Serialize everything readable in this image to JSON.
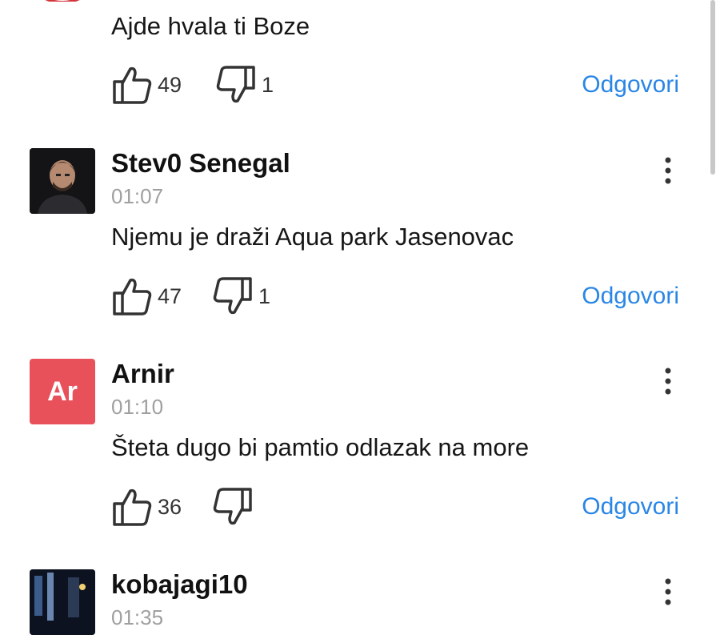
{
  "comments": [
    {
      "user": "",
      "time": "",
      "text": "Ajde hvala ti Boze",
      "likes": "49",
      "dislikes": "1",
      "reply": "Odgovori"
    },
    {
      "user": "Stev0 Senegal",
      "time": "01:07",
      "text": "Njemu je draži Aqua park Jasenovac",
      "likes": "47",
      "dislikes": "1",
      "reply": "Odgovori"
    },
    {
      "user": "Arnir",
      "initials": "Ar",
      "avatar_color": "#e8515a",
      "time": "01:10",
      "text": "Šteta dugo bi pamtio odlazak na more",
      "likes": "36",
      "dislikes": "",
      "reply": "Odgovori"
    },
    {
      "user": "kobajagi10",
      "time": "01:35"
    }
  ],
  "colors": {
    "reply_link": "#2a86e5",
    "time": "#a0a0a0",
    "text": "#161616"
  },
  "icons": [
    "thumbs-up-icon",
    "thumbs-down-icon",
    "more-vertical-icon"
  ]
}
